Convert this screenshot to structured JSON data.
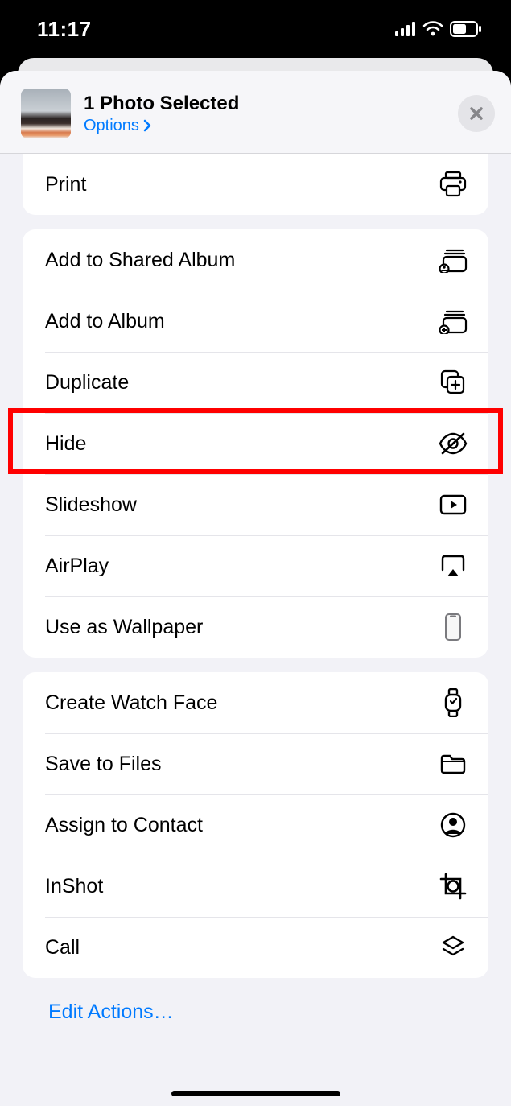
{
  "statusbar": {
    "time": "11:17"
  },
  "header": {
    "title": "1 Photo Selected",
    "options": "Options"
  },
  "groups": [
    {
      "rows": [
        {
          "key": "print",
          "label": "Print",
          "icon": "printer-icon"
        }
      ]
    },
    {
      "rows": [
        {
          "key": "add-shared-album",
          "label": "Add to Shared Album",
          "icon": "shared-album-icon"
        },
        {
          "key": "add-album",
          "label": "Add to Album",
          "icon": "add-album-icon"
        },
        {
          "key": "duplicate",
          "label": "Duplicate",
          "icon": "duplicate-icon"
        },
        {
          "key": "hide",
          "label": "Hide",
          "icon": "eye-slash-icon",
          "highlighted": true
        },
        {
          "key": "slideshow",
          "label": "Slideshow",
          "icon": "play-rect-icon"
        },
        {
          "key": "airplay",
          "label": "AirPlay",
          "icon": "airplay-icon"
        },
        {
          "key": "wallpaper",
          "label": "Use as Wallpaper",
          "icon": "phone-outline-icon"
        }
      ]
    },
    {
      "rows": [
        {
          "key": "watch-face",
          "label": "Create Watch Face",
          "icon": "watch-icon"
        },
        {
          "key": "save-files",
          "label": "Save to Files",
          "icon": "folder-icon"
        },
        {
          "key": "assign-contact",
          "label": "Assign to Contact",
          "icon": "contact-icon"
        },
        {
          "key": "inshot",
          "label": "InShot",
          "icon": "inshot-icon"
        },
        {
          "key": "call",
          "label": "Call",
          "icon": "layers-icon"
        }
      ]
    }
  ],
  "footer": {
    "edit_actions": "Edit Actions…"
  }
}
